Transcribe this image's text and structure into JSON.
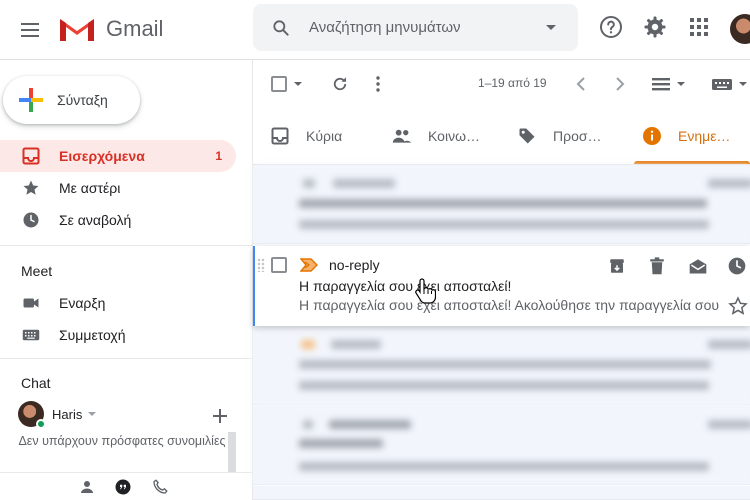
{
  "header": {
    "app_name": "Gmail",
    "search_placeholder": "Αναζήτηση μηνυμάτων"
  },
  "sidebar": {
    "compose_label": "Σύνταξη",
    "items": [
      {
        "label": "Εισερχόμενα",
        "count": "1",
        "icon": "inbox-icon",
        "active": true
      },
      {
        "label": "Με αστέρι",
        "icon": "star-icon"
      },
      {
        "label": "Σε αναβολή",
        "icon": "clock-icon"
      }
    ],
    "meet": {
      "title": "Meet",
      "items": [
        {
          "label": "Εναρξη",
          "icon": "video-camera-icon"
        },
        {
          "label": "Συμμετοχή",
          "icon": "keyboard-icon"
        }
      ]
    },
    "chat": {
      "title": "Chat",
      "user": "Haris",
      "empty_text": "Δεν υπάρχουν πρόσφατες συνομιλίες"
    }
  },
  "toolbar": {
    "count": "1–19 από 19"
  },
  "tabs": [
    {
      "label": "Κύρια",
      "icon": "inbox-tab-icon"
    },
    {
      "label": "Κοινω…",
      "icon": "people-icon"
    },
    {
      "label": "Προσ…",
      "icon": "tag-icon"
    },
    {
      "label": "Ενημε…",
      "icon": "info-icon",
      "active": true
    }
  ],
  "active_mail": {
    "sender": "no-reply",
    "subject": "Η παραγγελία σου έχει αποσταλεί!",
    "snippet": "Η παραγγελία σου έχει αποσταλεί! Ακολούθησε την παραγγελία σου"
  },
  "colors": {
    "accent_red": "#d93025",
    "active_tab_orange": "#e37400",
    "selection_blue": "#4285f4"
  }
}
